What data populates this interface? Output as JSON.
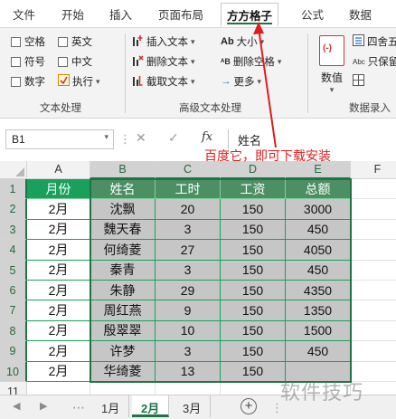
{
  "ribbon_tabs": [
    "文件",
    "开始",
    "插入",
    "页面布局",
    "方方格子",
    "公式",
    "数据"
  ],
  "ribbon_text_group": {
    "label": "文本处理",
    "checks": [
      "空格",
      "英文",
      "符号",
      "中文",
      "数字"
    ],
    "exec_label": "执行"
  },
  "ribbon_adv_group": {
    "label": "高级文本处理",
    "insert_text": "插入文本",
    "delete_text": "删除文本",
    "extract_text": "截取文本",
    "case_label": "大小",
    "delete_space": "删除空格",
    "more": "更多"
  },
  "ribbon_data_group": {
    "label": "数据录入",
    "numeric": "数值",
    "round": "四舍五",
    "keep": "只保留"
  },
  "formula_bar": {
    "name_box": "B1",
    "fx": "fx",
    "value": "姓名"
  },
  "annotation": "百度它，即可下载安装",
  "columns": [
    "A",
    "B",
    "C",
    "D",
    "E",
    "F"
  ],
  "rows": [
    "1",
    "2",
    "3",
    "4",
    "5",
    "6",
    "7",
    "8",
    "9",
    "10",
    "11"
  ],
  "table": {
    "headers": [
      "月份",
      "姓名",
      "工时",
      "工资",
      "总额"
    ],
    "rows": [
      [
        "2月",
        "沈飘",
        "20",
        "150",
        "3000"
      ],
      [
        "2月",
        "魏天春",
        "3",
        "150",
        "450"
      ],
      [
        "2月",
        "何绮菱",
        "27",
        "150",
        "4050"
      ],
      [
        "2月",
        "秦青",
        "3",
        "150",
        "450"
      ],
      [
        "2月",
        "朱静",
        "29",
        "150",
        "4350"
      ],
      [
        "2月",
        "周红燕",
        "9",
        "150",
        "1350"
      ],
      [
        "2月",
        "殷翠翠",
        "10",
        "150",
        "1500"
      ],
      [
        "2月",
        "许梦",
        "3",
        "150",
        "450"
      ],
      [
        "2月",
        "华绮菱",
        "13",
        "150",
        ""
      ]
    ]
  },
  "sheet_tabs": [
    "1月",
    "2月",
    "3月"
  ],
  "active_sheet": "2月",
  "watermark": "软件技巧",
  "colors": {
    "accent": "#217346",
    "header_green": "#19a05a",
    "annotation_red": "#e21c1c",
    "selection_gray": "#c6c6c6"
  }
}
